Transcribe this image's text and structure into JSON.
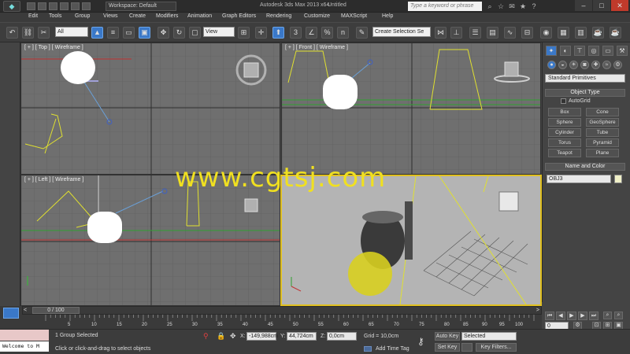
{
  "titlebar": {
    "workspace": "Workspace: Default",
    "app_title": "Autodesk 3ds Max  2013 x64",
    "file_title": "Untitled",
    "search_placeholder": "Type a keyword or phrase"
  },
  "menu": [
    "Edit",
    "Tools",
    "Group",
    "Views",
    "Create",
    "Modifiers",
    "Animation",
    "Graph Editors",
    "Rendering",
    "Customize",
    "MAXScript",
    "Help"
  ],
  "toolbar": {
    "selection_filter": "All",
    "ref_coord": "View",
    "named_selection": "Create Selection Se",
    "snap_label": "3",
    "angle_snap_label": "n"
  },
  "viewports": {
    "top_label": "[ + ] [ Top ] [ Wireframe ]",
    "front_label": "[ + ] [ Front ] [ Wireframe ]",
    "left_label": "[ + ] [ Left ] [ Wireframe ]"
  },
  "watermark": "www.cgtsj.com",
  "command_panel": {
    "primitive_type": "Standard Primitives",
    "object_type_title": "Object Type",
    "autogrid": "AutoGrid",
    "primitives": [
      "Box",
      "Cone",
      "Sphere",
      "GeoSphere",
      "Cylinder",
      "Tube",
      "Torus",
      "Pyramid",
      "Teapot",
      "Plane"
    ],
    "name_color_title": "Name and Color",
    "object_name": "OBJ3"
  },
  "timeline": {
    "frame_counter": "0 / 100",
    "ticks": [
      "5",
      "10",
      "15",
      "20",
      "25",
      "30",
      "35",
      "40",
      "45",
      "50",
      "55",
      "60",
      "65",
      "70",
      "75",
      "80",
      "85",
      "90",
      "95",
      "100"
    ]
  },
  "status": {
    "maxscript_mini": "Welcome to M",
    "selection": "1 Group Selected",
    "prompt": "Click or click-and-drag to select objects",
    "x_label": "X:",
    "x_value": "-149,988cm",
    "y_label": "Y:",
    "y_value": "44,724cm",
    "z_label": "Z:",
    "z_value": "0,0cm",
    "grid": "Grid = 10,0cm",
    "add_time_tag": "Add Time Tag",
    "auto_key": "Auto Key",
    "set_key": "Set Key",
    "key_mode": "Selected",
    "key_filters": "Key Filters...",
    "frame": "0"
  },
  "colors": {
    "viewport_bg": "#6f6f6f",
    "persp_bg": "#b4b4b4",
    "active_border": "#e0c020",
    "watermark": "#f0e020",
    "ui_bg": "#444444"
  }
}
